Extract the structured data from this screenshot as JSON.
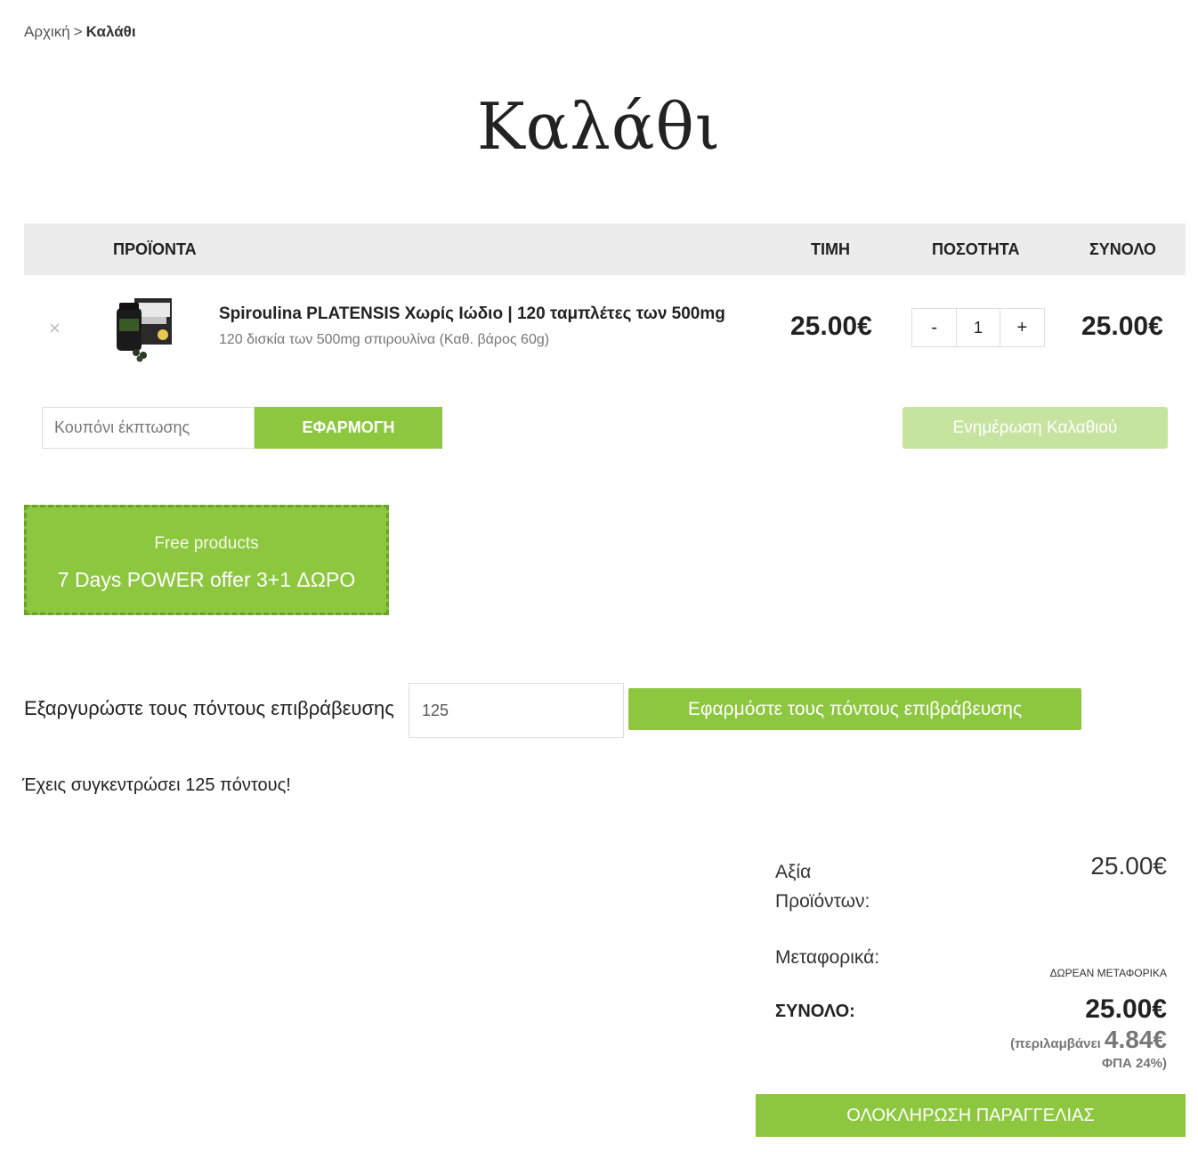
{
  "breadcrumb": {
    "home": "Αρχική",
    "separator": ">",
    "current": "Καλάθι"
  },
  "page_title": "Καλάθι",
  "table_header": {
    "products": "ΠΡΟΪΟΝΤΑ",
    "price": "ΤΙΜΗ",
    "quantity": "ΠΟΣΟΤΗΤΑ",
    "total": "ΣΥΝΟΛΟ"
  },
  "cart_item": {
    "remove": "×",
    "name": "Spiroulina PLATENSIS Χωρίς Ιώδιο | 120 ταμπλέτες των 500mg",
    "subtitle": "120 δισκία των 500mg σπιρουλίνα (Καθ. βάρος 60g)",
    "price": "25.00€",
    "qty_minus": "-",
    "qty_value": "1",
    "qty_plus": "+",
    "total": "25.00€"
  },
  "coupon": {
    "placeholder": "Κουπόνι έκπτωσης",
    "apply_label": "ΕΦΑΡΜΟΓΗ"
  },
  "update_cart_label": "Ενημέρωση Καλαθιού",
  "free_products": {
    "title": "Free products",
    "offer": "7 Days POWER offer 3+1 ΔΩΡΟ"
  },
  "redeem": {
    "label": "Εξαργυρώστε τους πόντους επιβράβευσης",
    "value": "125",
    "button": "Εφαρμόστε τους πόντους επιβράβευσης"
  },
  "points_message": "Έχεις συγκεντρώσει 125 πόντους!",
  "totals": {
    "subtotal_label": "Αξία Προϊόντων:",
    "subtotal_value": "25.00€",
    "shipping_label": "Μεταφορικά:",
    "shipping_value": "ΔΩΡΕΑΝ ΜΕΤΑΦΟΡΙΚΑ",
    "total_label": "ΣΥΝΟΛΟ:",
    "total_value": "25.00€",
    "vat_prefix": "(περιλαμβάνει",
    "vat_amount": "4.84€",
    "vat_suffix": "ΦΠΑ 24%)"
  },
  "checkout_label": "ΟΛΟΚΛΗΡΩΣΗ ΠΑΡΑΓΓΕΛΙΑΣ",
  "colors": {
    "accent": "#8dc63f",
    "accent_light": "#c6e3a0",
    "header_bg": "#ececec"
  }
}
